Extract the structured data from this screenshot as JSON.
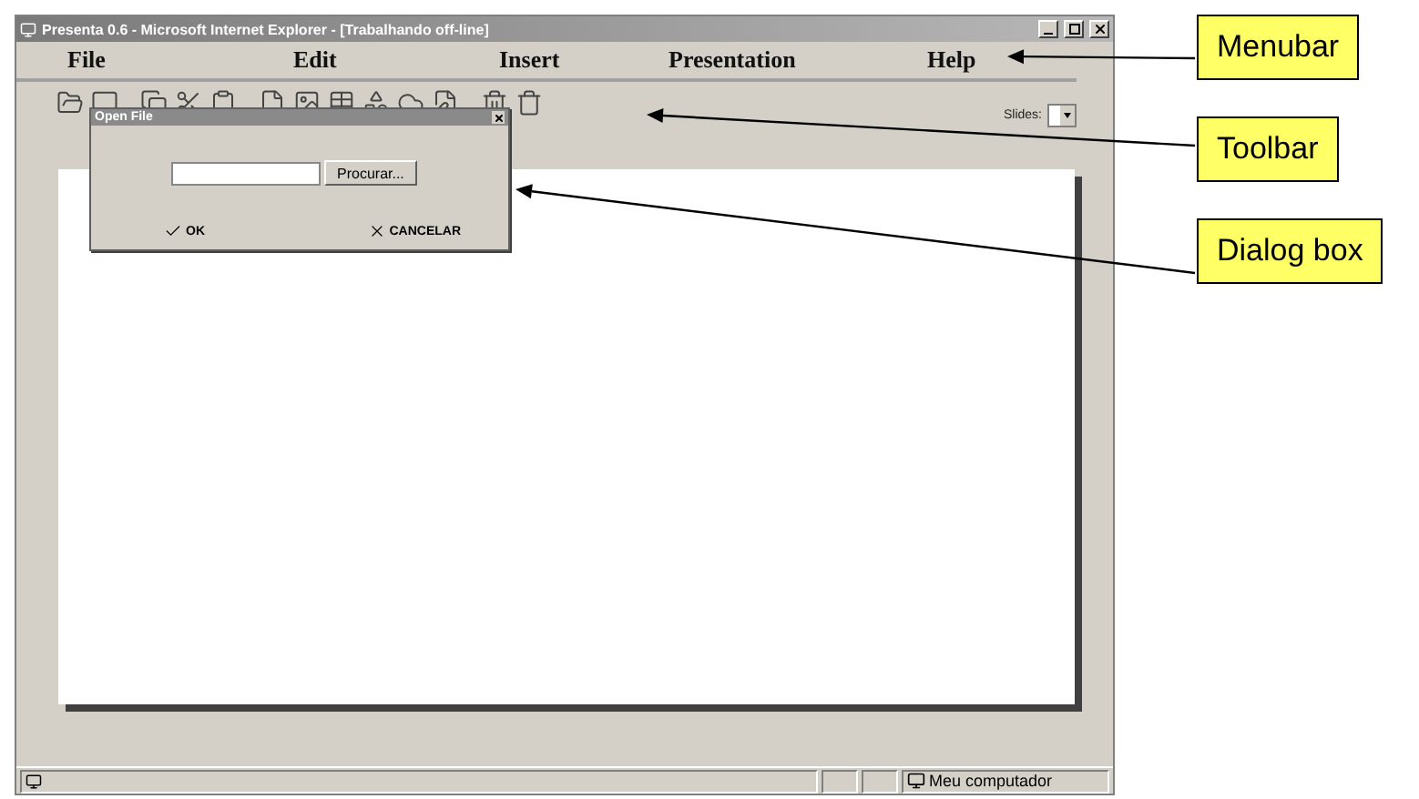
{
  "window": {
    "title": "Presenta 0.6 - Microsoft Internet Explorer - [Trabalhando off-line]"
  },
  "menubar": {
    "items": [
      {
        "label": "File"
      },
      {
        "label": "Edit"
      },
      {
        "label": "Insert"
      },
      {
        "label": "Presentation"
      },
      {
        "label": "Help"
      }
    ]
  },
  "toolbar": {
    "slides_label": "Slides:"
  },
  "dialog": {
    "title": "Open File",
    "browse_button": "Procurar...",
    "ok_button": "OK",
    "cancel_button": "CANCELAR"
  },
  "status_bar": {
    "zone": "Meu computador"
  },
  "annotations": [
    {
      "label": "Menubar"
    },
    {
      "label": "Toolbar"
    },
    {
      "label": "Dialog box"
    }
  ]
}
